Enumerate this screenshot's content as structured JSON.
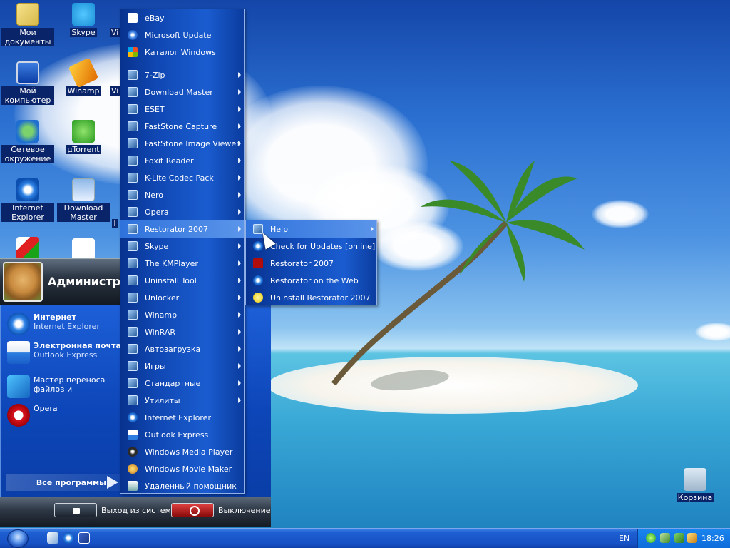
{
  "desktop": {
    "icons": [
      {
        "label": "Мои документы",
        "icon": "my-documents-icon"
      },
      {
        "label": "Skype",
        "icon": "skype-icon"
      },
      {
        "label": "Vi",
        "icon": "partial-icon"
      },
      {
        "label": "Мой компьютер",
        "icon": "my-computer-icon"
      },
      {
        "label": "Winamp",
        "icon": "winamp-icon"
      },
      {
        "label": "Vi",
        "icon": "partial-icon"
      },
      {
        "label": "Сетевое окружение",
        "icon": "network-icon"
      },
      {
        "label": "µTorrent",
        "icon": "utorrent-icon"
      },
      {
        "label": "Internet Explorer",
        "icon": "internet-explorer-icon"
      },
      {
        "label": "Download Master",
        "icon": "download-master-icon"
      },
      {
        "label": "I",
        "icon": "partial-icon"
      },
      {
        "label": "",
        "icon": "app-icon"
      },
      {
        "label": "",
        "icon": "ebay-icon"
      },
      {
        "label": "Корзина",
        "icon": "recycle-bin-icon"
      }
    ]
  },
  "start_menu": {
    "user_name": "Администратор",
    "pinned": [
      {
        "title": "Интернет",
        "subtitle": "Internet Explorer",
        "icon": "internet-explorer-icon"
      },
      {
        "title": "Электронная почта",
        "subtitle": "Outlook Express",
        "icon": "outlook-express-icon"
      },
      {
        "title": "Мастер переноса файлов и параметров",
        "subtitle": "",
        "icon": "migration-wizard-icon"
      },
      {
        "title": "Opera",
        "subtitle": "",
        "icon": "opera-icon"
      }
    ],
    "all_programs_label": "Все программы",
    "logoff_label": "Выход из системы",
    "shutdown_label": "Выключение"
  },
  "programs_menu": {
    "items": [
      {
        "label": "eBay",
        "icon": "ebay-icon",
        "submenu": false
      },
      {
        "label": "Microsoft Update",
        "icon": "microsoft-update-icon",
        "submenu": false
      },
      {
        "label": "Каталог Windows",
        "icon": "windows-catalog-icon",
        "submenu": false
      },
      {
        "label": "7-Zip",
        "icon": "folder-icon",
        "submenu": true
      },
      {
        "label": "Download Master",
        "icon": "folder-icon",
        "submenu": true
      },
      {
        "label": "ESET",
        "icon": "folder-icon",
        "submenu": true
      },
      {
        "label": "FastStone Capture",
        "icon": "folder-icon",
        "submenu": true
      },
      {
        "label": "FastStone Image Viewer",
        "icon": "folder-icon",
        "submenu": true
      },
      {
        "label": "Foxit Reader",
        "icon": "folder-icon",
        "submenu": true
      },
      {
        "label": "K-Lite Codec Pack",
        "icon": "folder-icon",
        "submenu": true
      },
      {
        "label": "Nero",
        "icon": "folder-icon",
        "submenu": true
      },
      {
        "label": "Opera",
        "icon": "folder-icon",
        "submenu": true
      },
      {
        "label": "Restorator 2007",
        "icon": "folder-icon",
        "submenu": true,
        "highlighted": true
      },
      {
        "label": "Skype",
        "icon": "folder-icon",
        "submenu": true
      },
      {
        "label": "The KMPlayer",
        "icon": "folder-icon",
        "submenu": true
      },
      {
        "label": "Uninstall Tool",
        "icon": "folder-icon",
        "submenu": true
      },
      {
        "label": "Unlocker",
        "icon": "folder-icon",
        "submenu": true
      },
      {
        "label": "Winamp",
        "icon": "folder-icon",
        "submenu": true
      },
      {
        "label": "WinRAR",
        "icon": "folder-icon",
        "submenu": true
      },
      {
        "label": "Автозагрузка",
        "icon": "folder-icon",
        "submenu": true
      },
      {
        "label": "Игры",
        "icon": "folder-icon",
        "submenu": true
      },
      {
        "label": "Стандартные",
        "icon": "folder-icon",
        "submenu": true
      },
      {
        "label": "Утилиты",
        "icon": "folder-icon",
        "submenu": true
      },
      {
        "label": "Internet Explorer",
        "icon": "internet-explorer-icon",
        "submenu": false
      },
      {
        "label": "Outlook Express",
        "icon": "outlook-express-icon",
        "submenu": false
      },
      {
        "label": "Windows Media Player",
        "icon": "windows-media-player-icon",
        "submenu": false
      },
      {
        "label": "Windows Movie Maker",
        "icon": "windows-movie-maker-icon",
        "submenu": false
      },
      {
        "label": "Удаленный помощник",
        "icon": "remote-assistance-icon",
        "submenu": false
      }
    ]
  },
  "restorator_submenu": {
    "items": [
      {
        "label": "Help",
        "icon": "folder-icon",
        "submenu": true,
        "highlighted": true
      },
      {
        "label": "Check for Updates [online]",
        "icon": "internet-explorer-icon",
        "submenu": false
      },
      {
        "label": "Restorator 2007",
        "icon": "restorator-icon",
        "submenu": false
      },
      {
        "label": "Restorator on the Web",
        "icon": "internet-explorer-icon",
        "submenu": false
      },
      {
        "label": "Uninstall Restorator 2007",
        "icon": "uninstall-icon",
        "submenu": false
      }
    ]
  },
  "taskbar": {
    "language": "EN",
    "clock": "18:26"
  }
}
